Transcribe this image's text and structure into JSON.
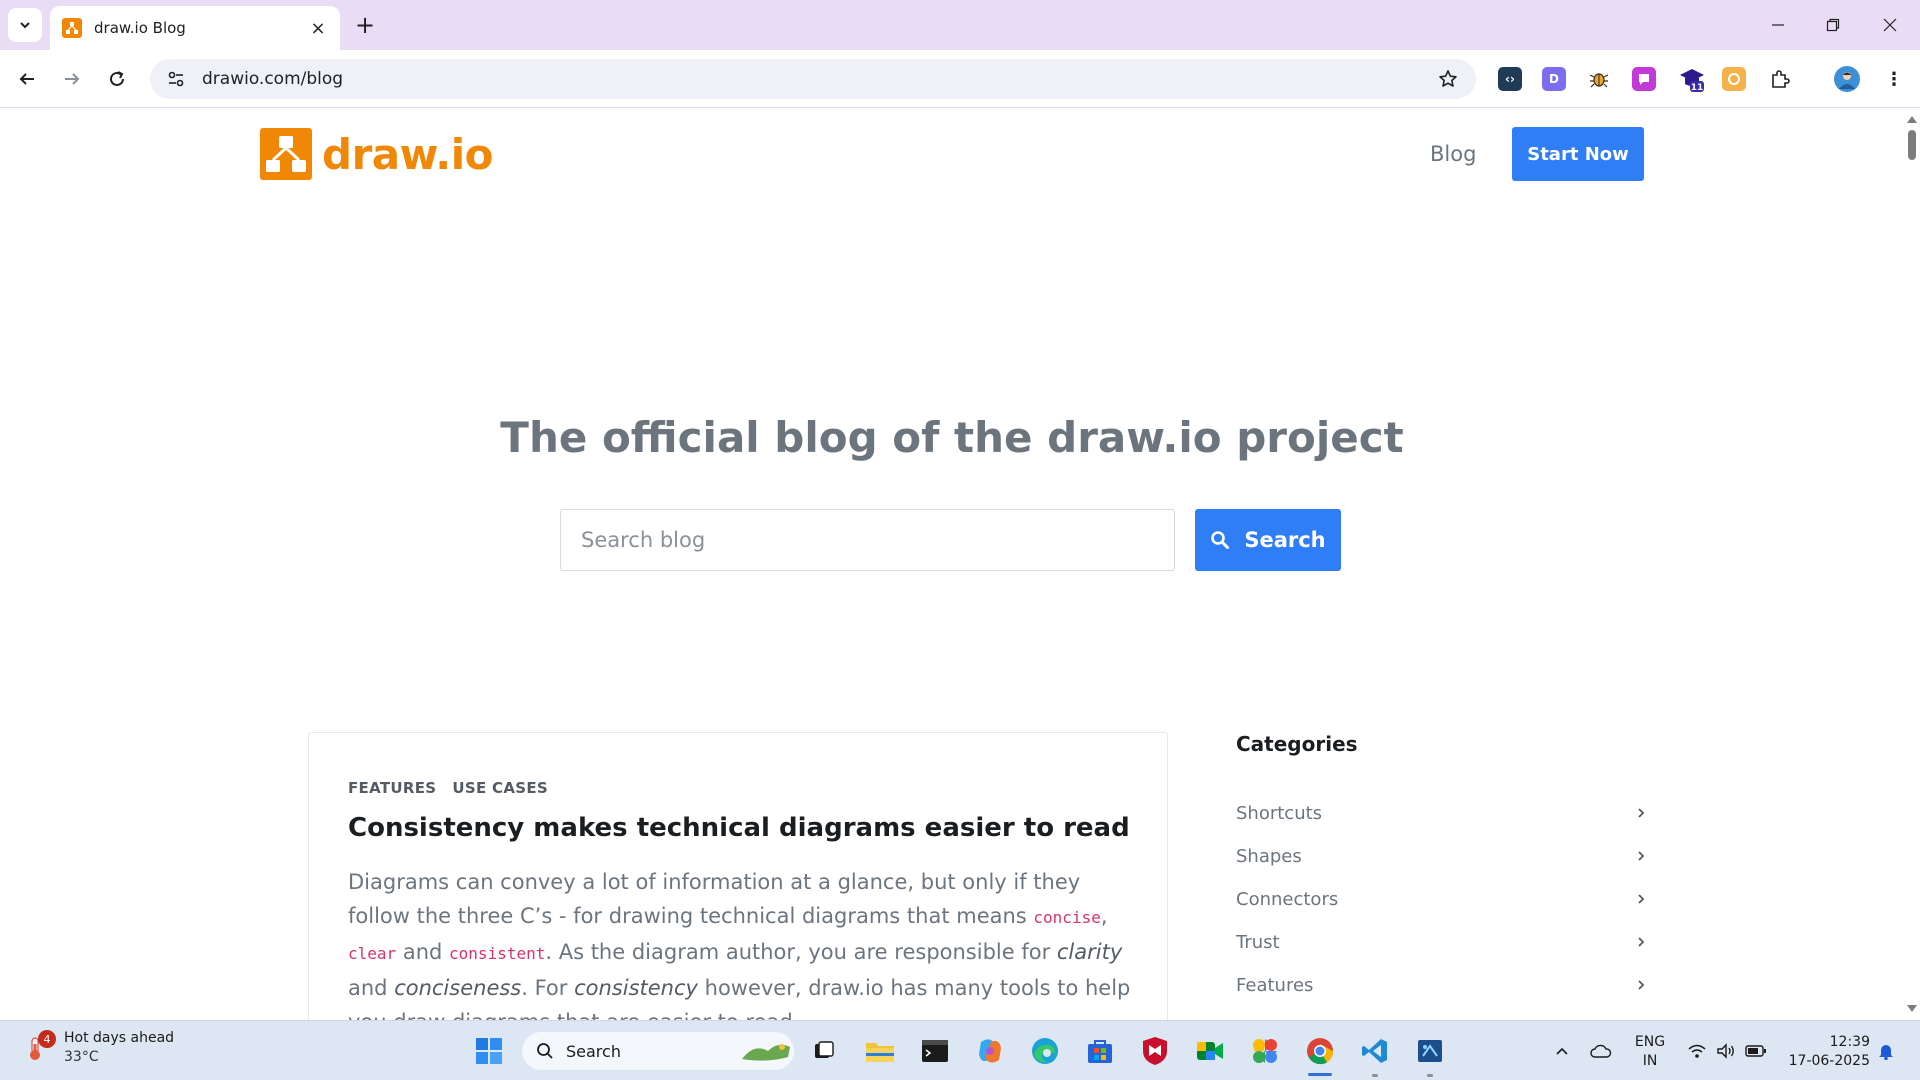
{
  "browser": {
    "tab_title": "draw.io Blog",
    "url": "drawio.com/blog",
    "profile_badge_count": "11"
  },
  "site": {
    "logo_text": "draw.io",
    "nav_blog": "Blog",
    "start_now": "Start Now",
    "hero_title": "The official blog of the draw.io project",
    "search_placeholder": "Search blog",
    "search_button": "Search"
  },
  "post": {
    "tags": [
      "FEATURES",
      "USE CASES"
    ],
    "title": "Consistency makes technical diagrams easier to read",
    "excerpt": {
      "p1": "Diagrams can convey a lot of information at a glance, but only if they follow the three C’s - for drawing technical diagrams that means ",
      "code1": "concise",
      "sep1": ", ",
      "code2": "clear",
      "and1": " and ",
      "code3": "consistent",
      "p2": ". As the diagram author, you are responsible for ",
      "em1": "clarity",
      "p3": " and ",
      "em2": "conciseness",
      "p4": ". For ",
      "em3": "consistency",
      "p5": " however, draw.io has many tools to help you draw diagrams that are easier to read."
    }
  },
  "sidebar": {
    "title": "Categories",
    "categories": [
      "Shortcuts",
      "Shapes",
      "Connectors",
      "Trust",
      "Features"
    ]
  },
  "taskbar": {
    "weather_title": "Hot days ahead",
    "weather_temp": "33°C",
    "weather_badge": "4",
    "search_label": "Search",
    "lang_line1": "ENG",
    "lang_line2": "IN",
    "time": "12:39",
    "date": "17-06-2025"
  },
  "colors": {
    "brand_orange": "#f08705",
    "primary_blue": "#2f7ef6",
    "tabstrip": "#e9dcf5"
  }
}
